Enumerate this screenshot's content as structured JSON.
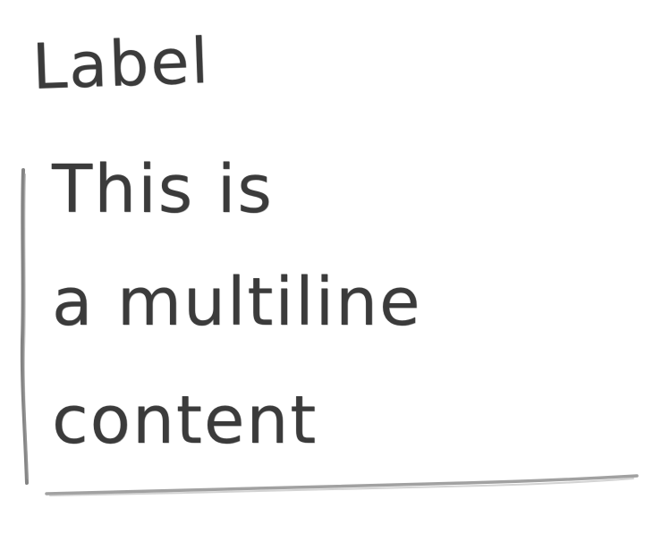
{
  "field": {
    "label": "Label",
    "content_lines": [
      "This is",
      "a multiline",
      "content"
    ]
  },
  "colors": {
    "pencil": "#3b3b3b",
    "background": "#ffffff"
  }
}
